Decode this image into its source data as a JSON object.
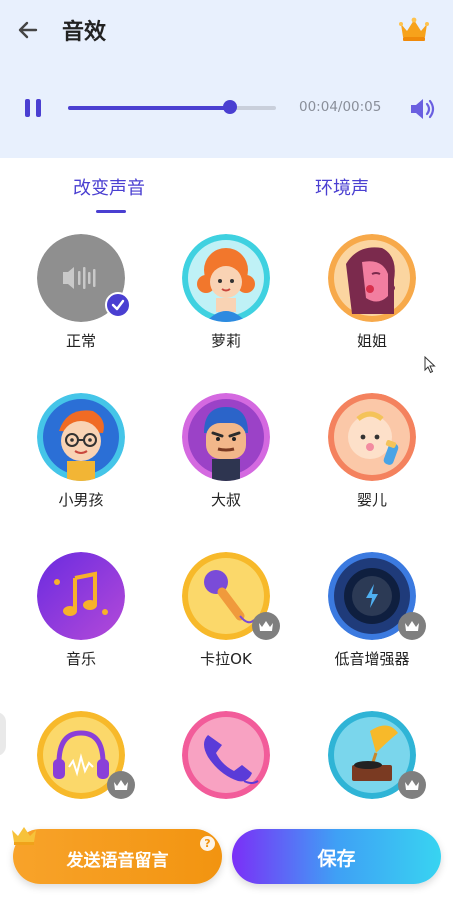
{
  "header": {
    "title": "音效",
    "time": "00:04/00:05",
    "progress_fraction": 0.78
  },
  "tabs": [
    {
      "label": "改变声音",
      "active": true
    },
    {
      "label": "环境声",
      "active": false
    }
  ],
  "effects": [
    {
      "label": "正常",
      "selected": true,
      "premium": false,
      "icon": "sound-wave-icon"
    },
    {
      "label": "萝莉",
      "selected": false,
      "premium": false,
      "icon": "girl-icon"
    },
    {
      "label": "姐姐",
      "selected": false,
      "premium": false,
      "icon": "woman-icon"
    },
    {
      "label": "小男孩",
      "selected": false,
      "premium": false,
      "icon": "boy-icon"
    },
    {
      "label": "大叔",
      "selected": false,
      "premium": false,
      "icon": "man-icon"
    },
    {
      "label": "婴儿",
      "selected": false,
      "premium": false,
      "icon": "baby-icon"
    },
    {
      "label": "音乐",
      "selected": false,
      "premium": false,
      "icon": "music-note-icon"
    },
    {
      "label": "卡拉OK",
      "selected": false,
      "premium": true,
      "icon": "microphone-icon"
    },
    {
      "label": "低音增强器",
      "selected": false,
      "premium": true,
      "icon": "bass-knob-icon"
    },
    {
      "label": "",
      "selected": false,
      "premium": true,
      "icon": "headphones-icon"
    },
    {
      "label": "",
      "selected": false,
      "premium": false,
      "icon": "phone-icon"
    },
    {
      "label": "",
      "selected": false,
      "premium": true,
      "icon": "gramophone-icon"
    }
  ],
  "footer": {
    "send_label": "发送语音留言",
    "save_label": "保存"
  },
  "colors": {
    "accent": "#4a3fd1",
    "header_bg": "#e8f0fd",
    "send_button": "#f29410"
  }
}
